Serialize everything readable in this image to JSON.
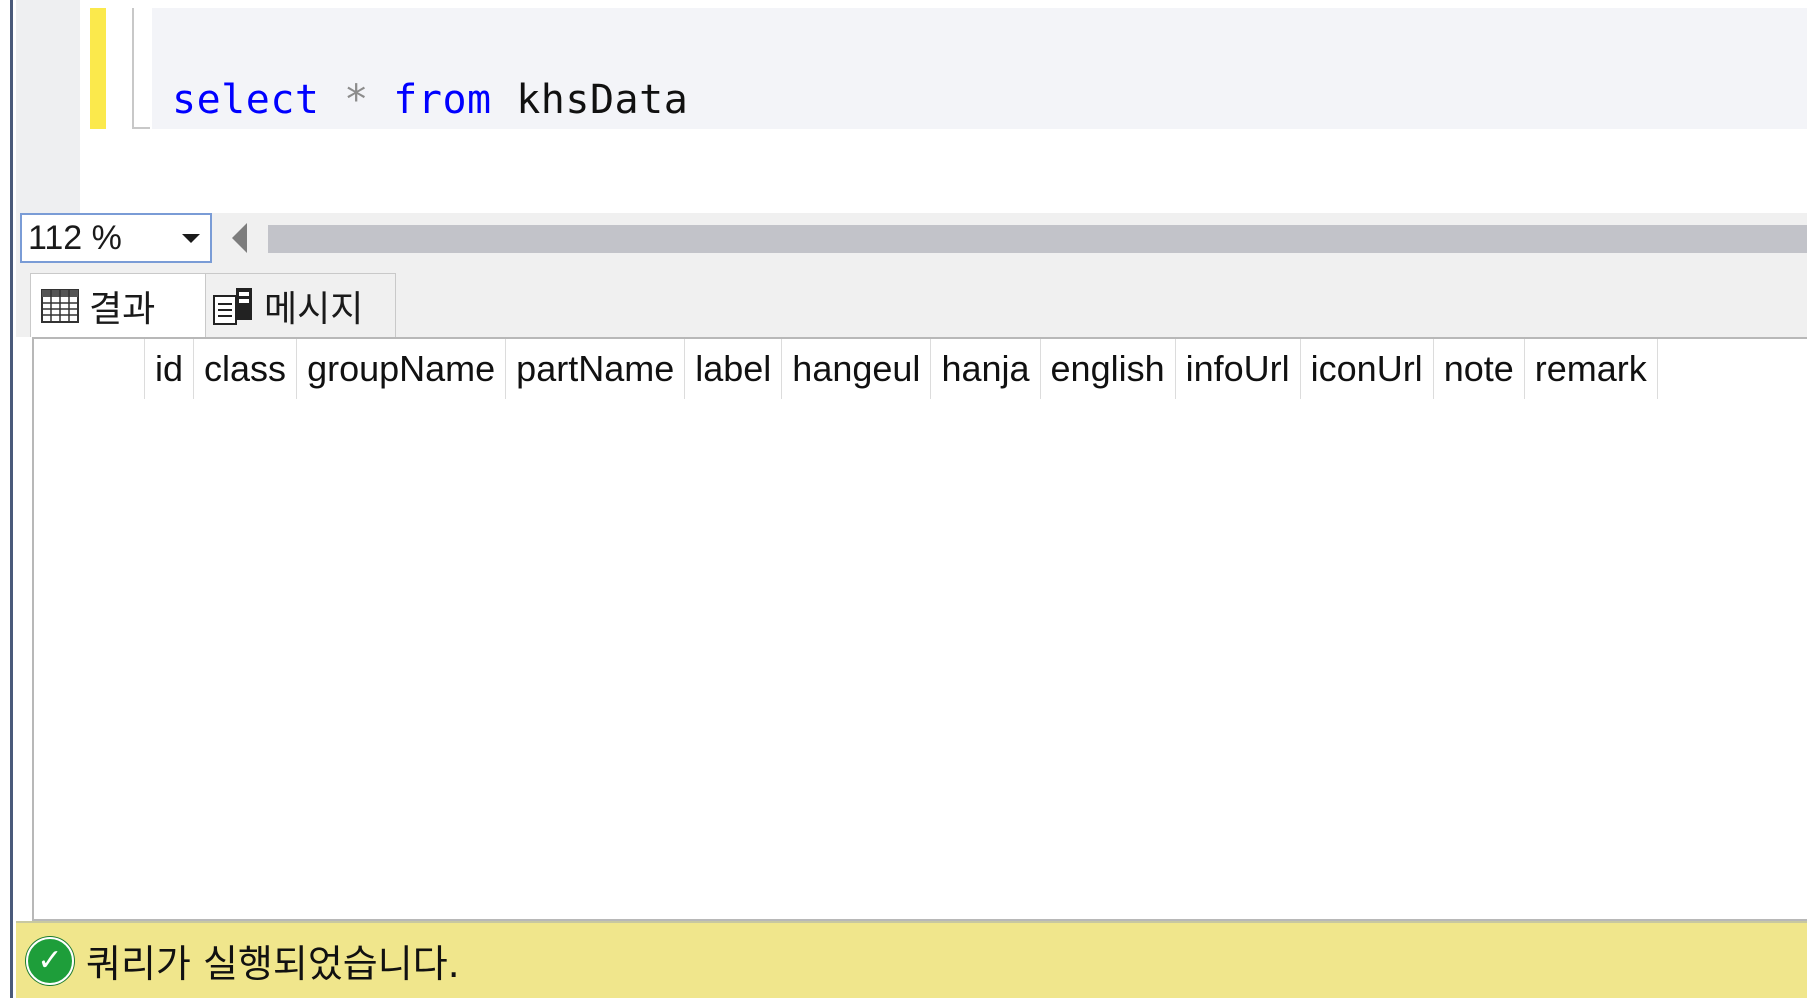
{
  "editor": {
    "code": {
      "kw1": "select",
      "op": "*",
      "kw2": "from",
      "table": "khsData"
    }
  },
  "zoom": {
    "value": "112 %"
  },
  "tabs": [
    {
      "label": "결과",
      "icon": "grid-icon"
    },
    {
      "label": "메시지",
      "icon": "messages-icon"
    }
  ],
  "grid": {
    "columns": [
      "id",
      "class",
      "groupName",
      "partName",
      "label",
      "hangeul",
      "hanja",
      "english",
      "infoUrl",
      "iconUrl",
      "note",
      "remark"
    ],
    "rows": []
  },
  "status": {
    "text": "쿼리가 실행되었습니다.",
    "icon": "success-check-icon",
    "bg_color": "#f0e68c"
  },
  "colors": {
    "keyword": "#0000ff",
    "change_bar": "#fbe94c",
    "success": "#1e9e3a"
  }
}
